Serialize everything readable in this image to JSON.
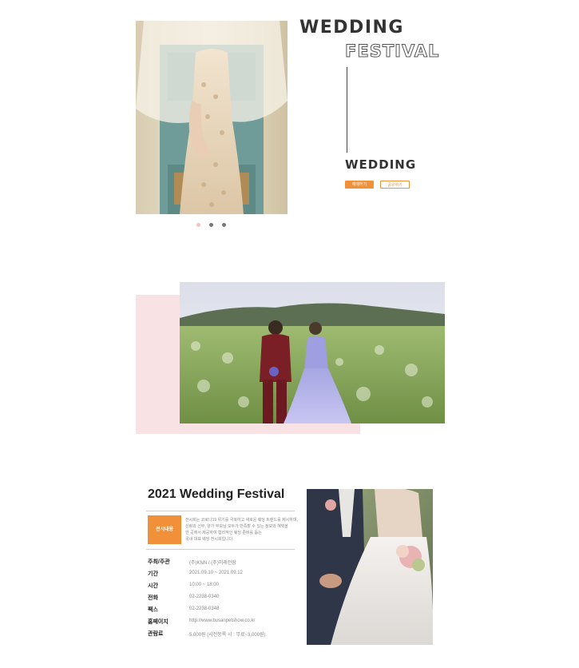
{
  "hero": {
    "title": "WEDDING",
    "outline_title": "FESTIVAL",
    "subtitle": "WEDDING",
    "buttons": {
      "primary": "예매하기",
      "secondary": "공유하기"
    },
    "slider": {
      "count": 3,
      "active_index": 0
    }
  },
  "info": {
    "title": "2021 Wedding Festival",
    "badge": "전시내용",
    "description": [
      "전시회는 코로나19 위기를 극복하고 새로운 웨딩 트렌드를 제시하며,",
      "신랑과 신부, 양가 부모님 모두가 만족할 수 있는 정보와 혜택을",
      "한 곳에서 제공하여 합리적인 웨딩 준비를 돕는",
      "국내 대표 웨딩 전시회입니다."
    ],
    "details": [
      {
        "label": "주최/주관",
        "value": "(주)KNN / (주)미래전람"
      },
      {
        "label": "기간",
        "value": "2021.09.10 ~ 2021.09.12"
      },
      {
        "label": "시간",
        "value": "10:00 ~ 18:00"
      },
      {
        "label": "전화",
        "value": "02-2238-0340"
      },
      {
        "label": "팩스",
        "value": "02-2238-0348"
      },
      {
        "label": "홈페이지",
        "value": "http://www.busanpetshow.co.kr"
      },
      {
        "label": "관람료",
        "value": "5,000원 (사전등록 시 : 무료~3,000원)"
      }
    ]
  },
  "colors": {
    "accent": "#f0913a",
    "pink": "#f8e2e3",
    "dot_active": "#f5c3c0",
    "dot_inactive": "#777777"
  }
}
